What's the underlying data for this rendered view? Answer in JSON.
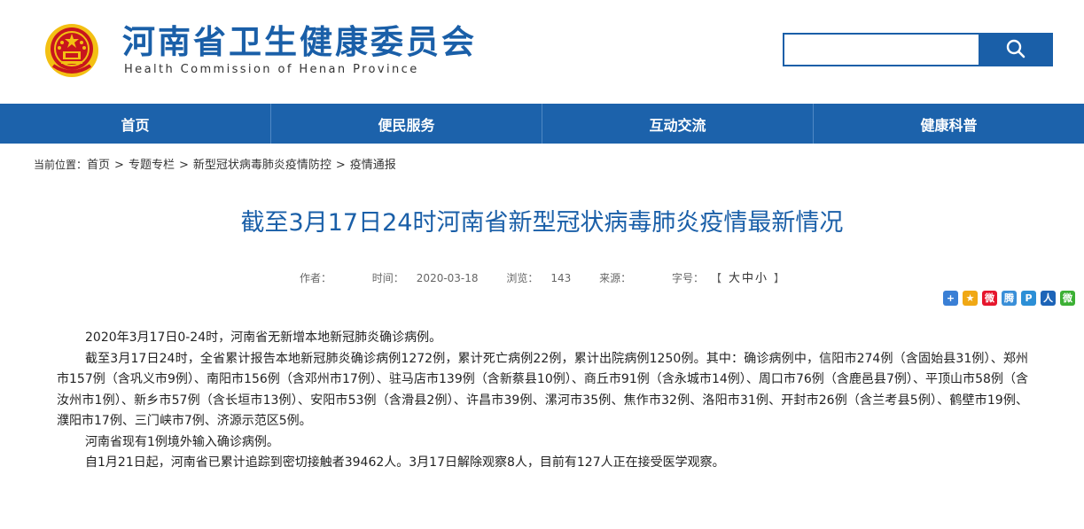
{
  "header": {
    "site_title": "河南省卫生健康委员会",
    "site_subtitle": "Health Commission of Henan Province",
    "search": {
      "placeholder": "",
      "button_icon": "search-icon"
    },
    "colors": {
      "brand_blue": "#1a5fa8",
      "emblem_red": "#c8161d",
      "emblem_gold": "#f3c013"
    }
  },
  "nav": {
    "items": [
      {
        "label": "首页"
      },
      {
        "label": "便民服务"
      },
      {
        "label": "互动交流"
      },
      {
        "label": "健康科普"
      }
    ]
  },
  "breadcrumb": {
    "prefix": "当前位置：",
    "items": [
      "首页",
      "专题专栏",
      "新型冠状病毒肺炎疫情防控",
      "疫情通报"
    ],
    "separator": ">"
  },
  "article": {
    "title": "截至3月17日24时河南省新型冠状病毒肺炎疫情最新情况",
    "meta": {
      "author_label": "作者：",
      "author": "",
      "time_label": "时间：",
      "time": "2020-03-18",
      "views_label": "浏览：",
      "views": "143",
      "source_label": "来源：",
      "source": "",
      "fontsize_label": "字号：",
      "fontsize_open": "【",
      "fontsize_large": "大",
      "fontsize_medium": "中",
      "fontsize_small": "小",
      "fontsize_close": "】"
    },
    "share_icons": [
      {
        "name": "share-more-icon",
        "glyph": "+",
        "color": "#3a7fd5"
      },
      {
        "name": "qzone-icon",
        "glyph": "★",
        "color": "#f0a814"
      },
      {
        "name": "weibo-icon",
        "glyph": "微",
        "color": "#e6162d"
      },
      {
        "name": "tencent-weibo-icon",
        "glyph": "腾",
        "color": "#3a8fd8"
      },
      {
        "name": "baidu-icon",
        "glyph": "P",
        "color": "#2c8fd6"
      },
      {
        "name": "renren-icon",
        "glyph": "人",
        "color": "#1d64b8"
      },
      {
        "name": "wechat-icon",
        "glyph": "微",
        "color": "#3cb034"
      }
    ],
    "paragraphs": [
      "2020年3月17日0-24时，河南省无新增本地新冠肺炎确诊病例。",
      "截至3月17日24时，全省累计报告本地新冠肺炎确诊病例1272例，累计死亡病例22例，累计出院病例1250例。其中：确诊病例中，信阳市274例（含固始县31例）、郑州市157例（含巩义市9例）、南阳市156例（含邓州市17例）、驻马店市139例（含新蔡县10例）、商丘市91例（含永城市14例）、周口市76例（含鹿邑县7例）、平顶山市58例（含汝州市1例）、新乡市57例（含长垣市13例）、安阳市53例（含滑县2例）、许昌市39例、漯河市35例、焦作市32例、洛阳市31例、开封市26例（含兰考县5例）、鹤壁市19例、濮阳市17例、三门峡市7例、济源示范区5例。",
      "河南省现有1例境外输入确诊病例。",
      "自1月21日起，河南省已累计追踪到密切接触者39462人。3月17日解除观察8人，目前有127人正在接受医学观察。"
    ]
  }
}
